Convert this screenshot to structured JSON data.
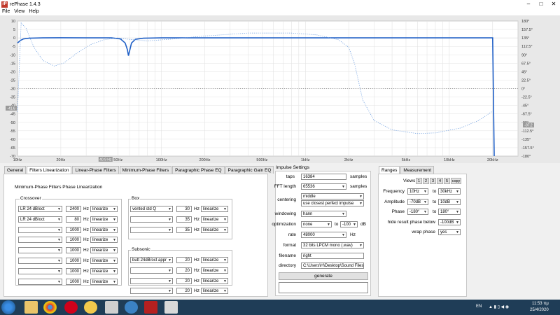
{
  "window": {
    "title": "rePhase 1.4.3"
  },
  "menu": [
    "File",
    "View",
    "Help"
  ],
  "chart_data": {
    "type": "line",
    "xscale": "log",
    "xlim": [
      10,
      30000
    ],
    "ylim": [
      -70,
      10
    ],
    "y2lim": [
      -180,
      180
    ],
    "x_ticks": [
      "10Hz",
      "20Hz",
      "50Hz",
      "100Hz",
      "200Hz",
      "500Hz",
      "1kHz",
      "2kHz",
      "5kHz",
      "10kHz",
      "20kHz"
    ],
    "x_tick_values": [
      10,
      20,
      50,
      100,
      200,
      500,
      1000,
      2000,
      5000,
      10000,
      20000
    ],
    "y_ticks": [
      10,
      5,
      0,
      -5,
      -10,
      -15,
      -20,
      -25,
      -30,
      -35,
      -40,
      -45,
      -50,
      -55,
      -60,
      -65,
      -70
    ],
    "y2_ticks": [
      "180°",
      "157.5°",
      "135°",
      "112.5°",
      "90°",
      "67.5°",
      "45°",
      "22.5°",
      "0°",
      "-22.5°",
      "-45°",
      "-67.5°",
      "-90°",
      "-112.5°",
      "-135°",
      "-157.5°",
      "-180°"
    ],
    "marker_left": "-41.6",
    "marker_right": "-97.2",
    "marker_bottom": "40.9 Hz",
    "grid": true,
    "series": [
      {
        "style": "solid",
        "points": [
          [
            10,
            -3
          ],
          [
            10.5,
            -1.5
          ],
          [
            11,
            -0.6
          ],
          [
            12,
            -0.2
          ],
          [
            15,
            0
          ],
          [
            20,
            0.1
          ],
          [
            30,
            0
          ],
          [
            45,
            0
          ],
          [
            52,
            -0.6
          ],
          [
            56,
            -3
          ],
          [
            58,
            -7
          ],
          [
            59,
            -10.5
          ],
          [
            60,
            -8
          ],
          [
            62,
            -3
          ],
          [
            66,
            -0.8
          ],
          [
            75,
            -0.2
          ],
          [
            100,
            0
          ],
          [
            200,
            0
          ],
          [
            500,
            0
          ],
          [
            1000,
            0
          ],
          [
            5000,
            0
          ],
          [
            10000,
            0
          ],
          [
            18000,
            0
          ],
          [
            20000,
            0
          ],
          [
            20500,
            -70
          ]
        ]
      },
      {
        "style": "dotted",
        "points": [
          [
            10,
            -62
          ],
          [
            10.6,
            175
          ],
          [
            11.5,
            160
          ],
          [
            13,
            110
          ],
          [
            15,
            75
          ],
          [
            18,
            60
          ],
          [
            21,
            68
          ],
          [
            26,
            95
          ],
          [
            32,
            117
          ],
          [
            40,
            130
          ],
          [
            50,
            135
          ],
          [
            60,
            131
          ],
          [
            80,
            127
          ],
          [
            120,
            132
          ],
          [
            200,
            140
          ],
          [
            400,
            148
          ],
          [
            800,
            148
          ],
          [
            1200,
            143
          ],
          [
            1700,
            130
          ],
          [
            2000,
            110
          ],
          [
            2200,
            65
          ],
          [
            2500,
            -30
          ],
          [
            3000,
            -85
          ],
          [
            4000,
            -110
          ],
          [
            6000,
            -120
          ],
          [
            8000,
            -118
          ],
          [
            12000,
            -105
          ],
          [
            16000,
            -85
          ],
          [
            20000,
            -60
          ]
        ]
      }
    ]
  },
  "tabs": [
    "General",
    "Filters Linearization",
    "Linear-Phase Filters",
    "Minimum-Phase Filters",
    "Paragraphic Phase EQ",
    "Paragraphic Gain EQ"
  ],
  "active_tab": 1,
  "lin": {
    "heading": "Minimum-Phase Filters Phase Linearization",
    "crossover_title": "Crossover",
    "crossover_rows": [
      {
        "type": "LR  24 dB/oct",
        "freq": "2400",
        "unit": "Hz",
        "mode": "linearize"
      },
      {
        "type": "LR  24 dB/oct",
        "freq": "80",
        "unit": "Hz",
        "mode": "linearize"
      },
      {
        "type": "",
        "freq": "1000",
        "unit": "Hz",
        "mode": "linearize"
      },
      {
        "type": "",
        "freq": "1000",
        "unit": "Hz",
        "mode": "linearize"
      },
      {
        "type": "",
        "freq": "1000",
        "unit": "Hz",
        "mode": "linearize"
      },
      {
        "type": "",
        "freq": "1000",
        "unit": "Hz",
        "mode": "linearize"
      },
      {
        "type": "",
        "freq": "1000",
        "unit": "Hz",
        "mode": "linearize"
      },
      {
        "type": "",
        "freq": "1000",
        "unit": "Hz",
        "mode": "linearize"
      }
    ],
    "box_title": "Box",
    "box_rows": [
      {
        "type": "vented std Q",
        "freq": "30",
        "unit": "Hz",
        "mode": "linearize"
      },
      {
        "type": "",
        "freq": "35",
        "unit": "Hz",
        "mode": "linearize"
      },
      {
        "type": "",
        "freq": "35",
        "unit": "Hz",
        "mode": "linearize"
      }
    ],
    "subsonic_title": "Subsonic",
    "subsonic_rows": [
      {
        "type": "butt 24dB/oct appr",
        "freq": "20",
        "unit": "Hz",
        "mode": "linearize"
      },
      {
        "type": "",
        "freq": "20",
        "unit": "Hz",
        "mode": "linearize"
      },
      {
        "type": "",
        "freq": "20",
        "unit": "Hz",
        "mode": "linearize"
      },
      {
        "type": "",
        "freq": "20",
        "unit": "Hz",
        "mode": "linearize"
      }
    ]
  },
  "impulse": {
    "title": "Impulse Settings",
    "taps_label": "taps",
    "taps": "16384",
    "taps_unit": "samples",
    "fft_label": "FFT length",
    "fft": "65536",
    "fft_unit": "samples",
    "centering_label": "centering",
    "centering1": "middle",
    "centering2": "use closest perfect impulse",
    "windowing_label": "windowing",
    "windowing": "hann",
    "opt_label": "optimization",
    "opt": "none",
    "opt_to": "to",
    "opt_db": "-100",
    "opt_unit": "dB",
    "rate_label": "rate",
    "rate": "48000",
    "rate_unit": "Hz",
    "format_label": "format",
    "format": "32 bits LPCM mono (.wav)",
    "filename_label": "filename",
    "filename": "right",
    "dir_label": "directory",
    "dir": "C:\\Users\\H\\Desktop\\Sound Files",
    "generate": "generate"
  },
  "ranges": {
    "tabs": [
      "Ranges",
      "Measurement"
    ],
    "views_label": "Views",
    "views": [
      "1",
      "2",
      "3",
      "4",
      "5"
    ],
    "copy": "copy",
    "freq_label": "Frequency",
    "freq_from": "10Hz",
    "freq_to": "30kHz",
    "amp_label": "Amplitude",
    "amp_from": "-70dB",
    "amp_to": "10dB",
    "phase_label": "Phase",
    "phase_from": "-180°",
    "phase_to": "180°",
    "to": "to",
    "hide_label": "hide result phase below",
    "hide": "-100dB",
    "wrap_label": "wrap phase",
    "wrap": "yes"
  },
  "taskbar": {
    "lang": "EN",
    "time": "11:53 πμ",
    "date": "25/4/2020"
  }
}
